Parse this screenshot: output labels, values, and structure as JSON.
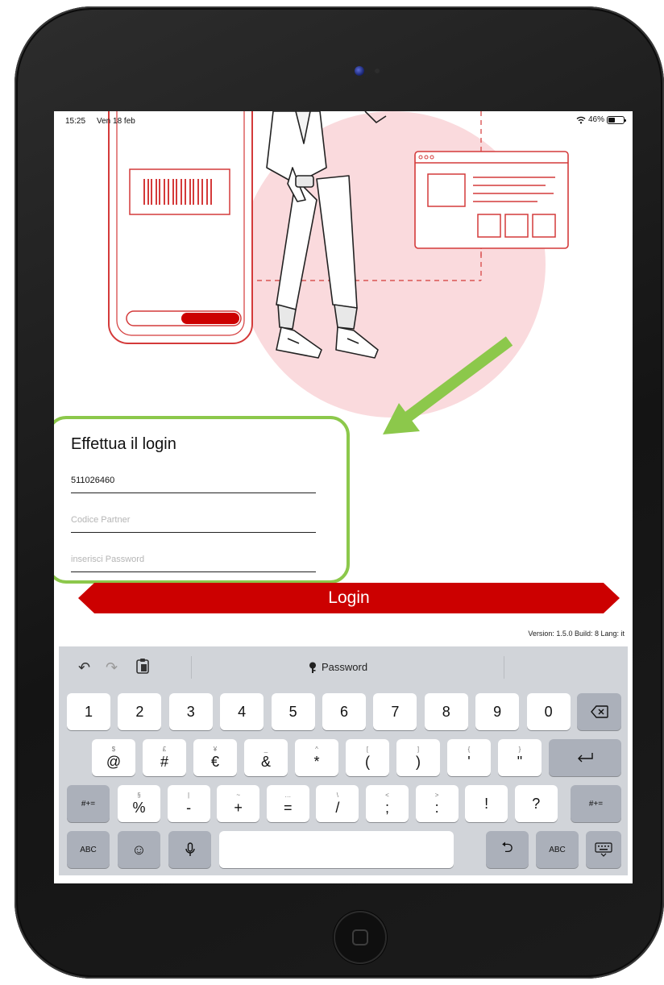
{
  "status_bar": {
    "time": "15:25",
    "date": "Ven 18 feb",
    "battery": "46%",
    "battery_level": 0.46
  },
  "login": {
    "title": "Effettua il login",
    "username_value": "511026460",
    "partner_placeholder": "Codice Partner",
    "password_placeholder": "inserisci Password",
    "button_label": "Login"
  },
  "version_text": "Version: 1.5.0 Build: 8  Lang: it",
  "colors": {
    "accent": "#cc0000",
    "highlight": "#8cc84b",
    "hero_bg": "#fadadd"
  },
  "keyboard": {
    "toolbar": {
      "undo_icon": "undo-icon",
      "redo_icon": "redo-icon",
      "paste_icon": "paste-icon",
      "password_label": "Password",
      "key_icon": "key-icon"
    },
    "row1": [
      "1",
      "2",
      "3",
      "4",
      "5",
      "6",
      "7",
      "8",
      "9",
      "0"
    ],
    "row2": [
      {
        "sub": "$",
        "main": "@"
      },
      {
        "sub": "£",
        "main": "#"
      },
      {
        "sub": "¥",
        "main": "€"
      },
      {
        "sub": "_",
        "main": "&"
      },
      {
        "sub": "^",
        "main": "*"
      },
      {
        "sub": "[",
        "main": "("
      },
      {
        "sub": "]",
        "main": ")"
      },
      {
        "sub": "{",
        "main": "'"
      },
      {
        "sub": "}",
        "main": "\""
      }
    ],
    "row3_left": "#+=",
    "row3": [
      {
        "sub": "§",
        "main": "%"
      },
      {
        "sub": "|",
        "main": "-"
      },
      {
        "sub": "~",
        "main": "+"
      },
      {
        "sub": "…",
        "main": "="
      },
      {
        "sub": "\\",
        "main": "/"
      },
      {
        "sub": "<",
        "main": ";"
      },
      {
        "sub": ">",
        "main": ":"
      },
      {
        "sub": "",
        "main": "!"
      },
      {
        "sub": "",
        "main": "?"
      }
    ],
    "row3_right": "#+=",
    "abc_left": "ABC",
    "abc_right": "ABC"
  }
}
